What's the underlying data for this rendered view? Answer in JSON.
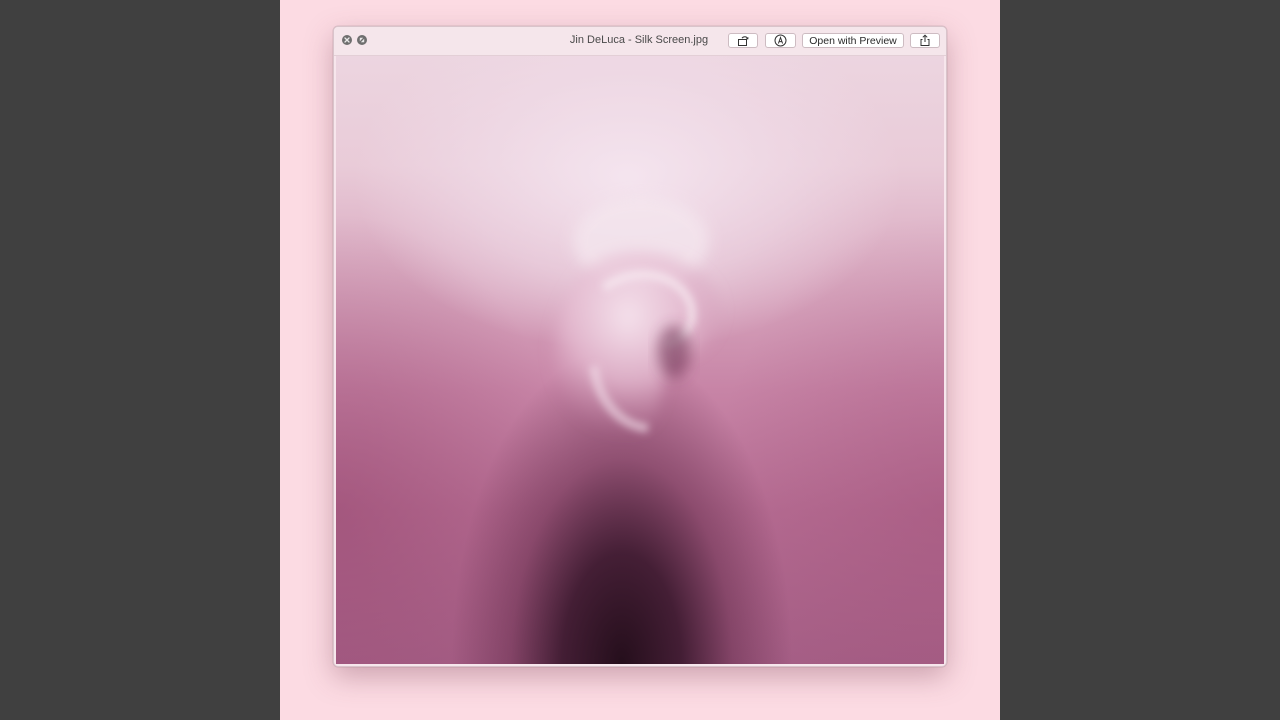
{
  "window": {
    "title": "Jin DeLuca - Silk Screen.jpg"
  },
  "toolbar": {
    "open_with_label": "Open with Preview"
  },
  "icons": {
    "close": "close-icon",
    "fullscreen": "fullscreen-icon",
    "rotate": "rotate-icon",
    "markup": "markup-pen-icon",
    "share": "share-icon"
  },
  "colors": {
    "desktop_background": "#fcdbe3",
    "window_background": "#f7e6ec",
    "letterbox": "#404040"
  }
}
